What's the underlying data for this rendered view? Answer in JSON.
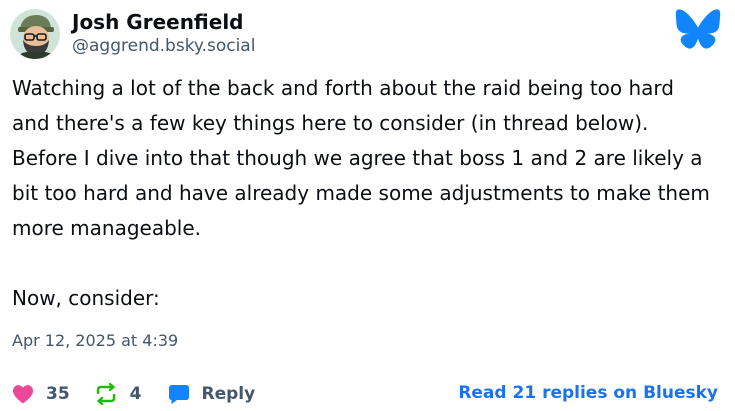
{
  "author": {
    "display_name": "Josh Greenfield",
    "handle": "@aggrend.bsky.social",
    "avatar_icon": "bearded-man-with-cap-avatar"
  },
  "brand": {
    "logo_icon": "bluesky-butterfly-icon",
    "color": "#1185fe"
  },
  "post": {
    "text": "Watching a lot of the back and forth about the raid being too hard and there's a few key things here to consider (in thread below). Before I dive into that though we agree that boss 1 and 2 are likely a bit too hard and have already made some adjustments to make them more manageable.\n\nNow, consider:",
    "timestamp": "Apr 12, 2025 at 4:39"
  },
  "actions": {
    "like": {
      "icon": "heart-icon",
      "count": "35",
      "color": "#ec4899"
    },
    "repost": {
      "icon": "repost-icon",
      "count": "4",
      "color": "#20bc07"
    },
    "reply": {
      "icon": "reply-bubble-icon",
      "label": "Reply",
      "color": "#1185fe"
    }
  },
  "read_replies_label": "Read 21 replies on Bluesky",
  "colors": {
    "text": "#0b0f14",
    "muted": "#42576c",
    "link": "#1a73e8"
  }
}
